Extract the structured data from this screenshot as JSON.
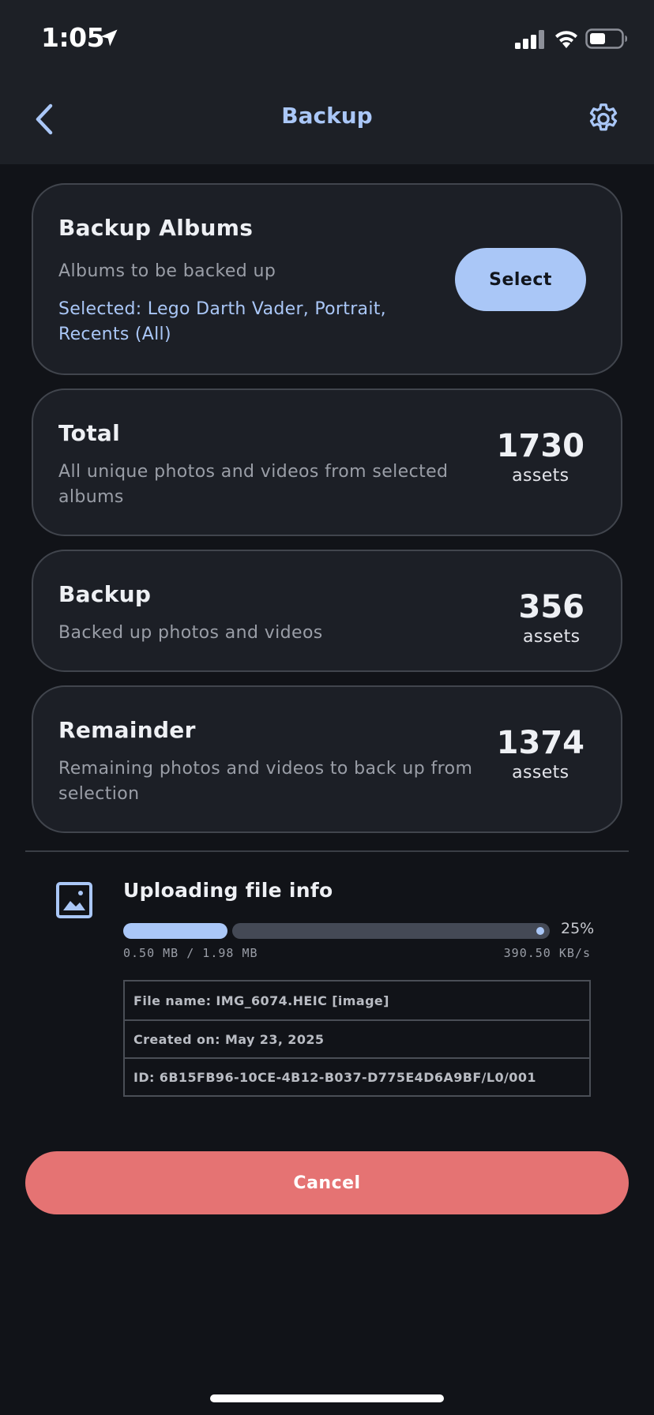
{
  "status_bar": {
    "time": "1:05"
  },
  "app_bar": {
    "title": "Backup"
  },
  "albums_card": {
    "title": "Backup Albums",
    "subtitle": "Albums to be backed up",
    "selected_line1": "Selected: Lego Darth Vader, Portrait,",
    "selected_line2": "Recents (All)",
    "select_label": "Select"
  },
  "total_card": {
    "title": "Total",
    "subtitle_line1": "All unique photos and videos from selected",
    "subtitle_line2": "albums",
    "count": "1730",
    "unit": "assets"
  },
  "backup_card": {
    "title": "Backup",
    "subtitle": "Backed up photos and videos",
    "count": "356",
    "unit": "assets"
  },
  "remainder_card": {
    "title": "Remainder",
    "subtitle_line1": "Remaining photos and videos to back up from",
    "subtitle_line2": "selection",
    "count": "1374",
    "unit": "assets"
  },
  "upload": {
    "title": "Uploading file info",
    "progress": 0.25,
    "percent_label": "25%",
    "size_label": "0.50 MB / 1.98 MB",
    "speed_label": "390.50 KB/s",
    "file_name": "File name: IMG_6074.HEIC [image]",
    "created_on": "Created on: May 23, 2025",
    "id": "ID: 6B15FB96-10CE-4B12-B037-D775E4D6A9BF/L0/001"
  },
  "cancel_label": "Cancel",
  "colors": {
    "accent": "#aac7f7",
    "cancel": "#e57373",
    "background": "#111318",
    "card": "#1c1f26"
  },
  "icons": [
    "location-arrow-icon",
    "signal-icon",
    "wifi-icon",
    "battery-icon",
    "back-arrow-icon",
    "gear-icon",
    "image-icon"
  ]
}
